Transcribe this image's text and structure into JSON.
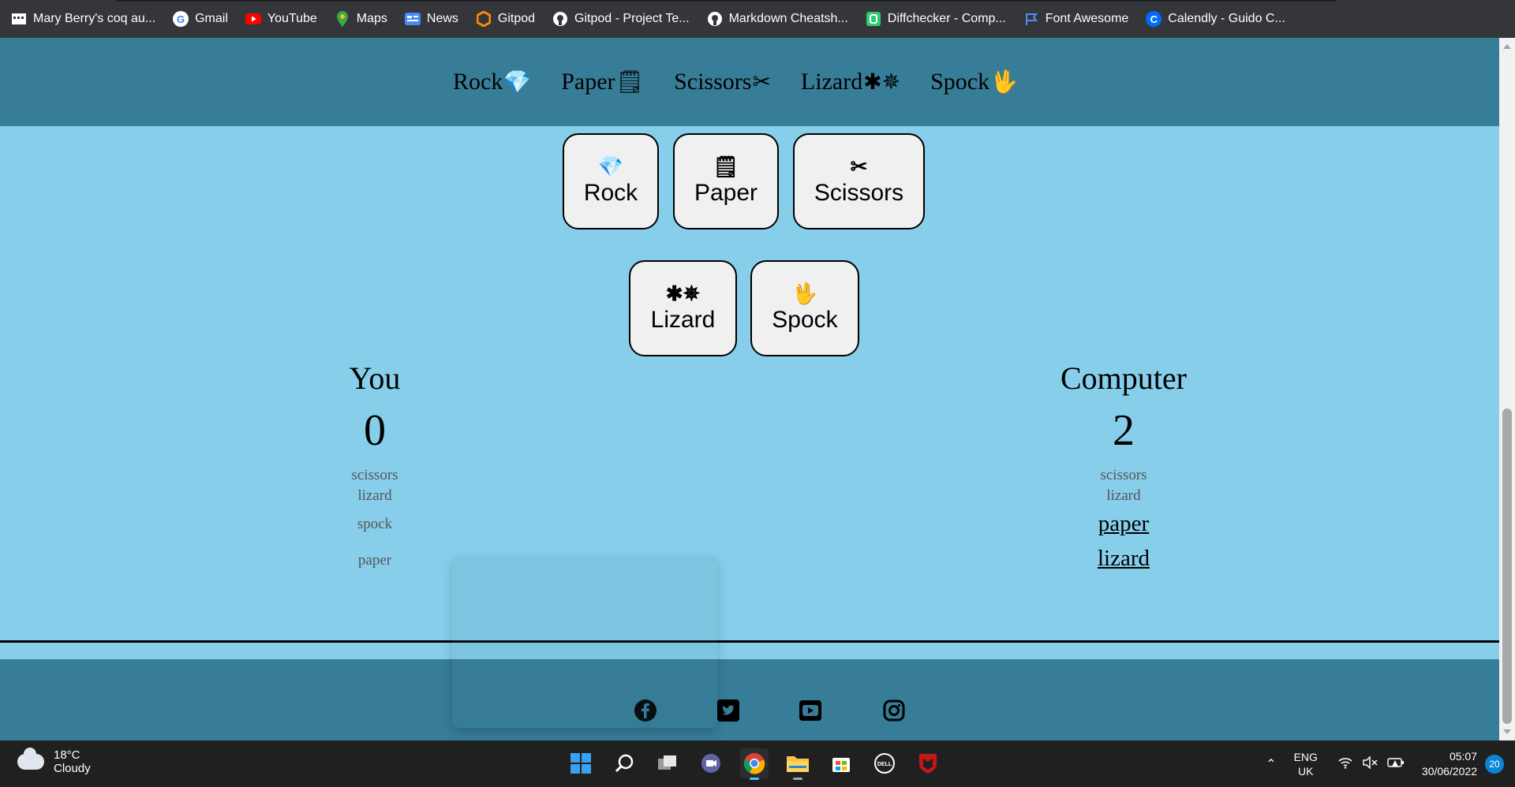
{
  "bookmarks": [
    {
      "label": "Mary Berry's coq au...",
      "icon": "apps-grid-icon",
      "color": "#ffffff"
    },
    {
      "label": "Gmail",
      "icon": "google-icon",
      "color": "#4285f4"
    },
    {
      "label": "YouTube",
      "icon": "youtube-icon",
      "color": "#ff0000"
    },
    {
      "label": "Maps",
      "icon": "maps-pin-icon",
      "color": "#34a853"
    },
    {
      "label": "News",
      "icon": "news-icon",
      "color": "#4a8af4"
    },
    {
      "label": "Gitpod",
      "icon": "gitpod-icon",
      "color": "#ff8a00"
    },
    {
      "label": "Gitpod - Project Te...",
      "icon": "github-icon",
      "color": "#ffffff"
    },
    {
      "label": "Markdown Cheatsh...",
      "icon": "github-icon",
      "color": "#ffffff"
    },
    {
      "label": "Diffchecker - Comp...",
      "icon": "diffchecker-icon",
      "color": "#2ecc71"
    },
    {
      "label": "Font Awesome",
      "icon": "flag-icon",
      "color": "#4e8df5"
    },
    {
      "label": "Calendly - Guido C...",
      "icon": "calendly-icon",
      "color": "#006bff"
    }
  ],
  "nav": {
    "items": [
      {
        "label": "Rock",
        "glyph": "💎"
      },
      {
        "label": "Paper",
        "glyph": "🗒"
      },
      {
        "label": "Scissors",
        "glyph": "✂"
      },
      {
        "label": "Lizard",
        "glyph": "✱✵"
      },
      {
        "label": "Spock",
        "glyph": "🖖"
      }
    ]
  },
  "choices": {
    "rock": {
      "label": "Rock",
      "glyph": "💎"
    },
    "paper": {
      "label": "Paper",
      "glyph": "🗒"
    },
    "scissors": {
      "label": "Scissors",
      "glyph": "✂"
    },
    "lizard": {
      "label": "Lizard",
      "glyph": "✱✵"
    },
    "spock": {
      "label": "Spock",
      "glyph": "🖖"
    }
  },
  "player": {
    "title": "You",
    "score": "0",
    "history": [
      "scissors",
      "lizard",
      "spock",
      "paper"
    ]
  },
  "computer": {
    "title": "Computer",
    "score": "2",
    "history": [
      "scissors",
      "lizard"
    ],
    "links": [
      "paper",
      "lizard"
    ]
  },
  "footer": {
    "icons": [
      "facebook-icon",
      "twitter-icon",
      "youtube-icon",
      "instagram-icon"
    ]
  },
  "taskbar": {
    "weather_temp": "18°C",
    "weather_desc": "Cloudy",
    "lang_line1": "ENG",
    "lang_line2": "UK",
    "time": "05:07",
    "date": "30/06/2022",
    "notification_count": "20"
  },
  "colors": {
    "page_bg": "#87ceeb",
    "nav_bg": "#377d97",
    "button_bg": "#f0f0f0"
  }
}
